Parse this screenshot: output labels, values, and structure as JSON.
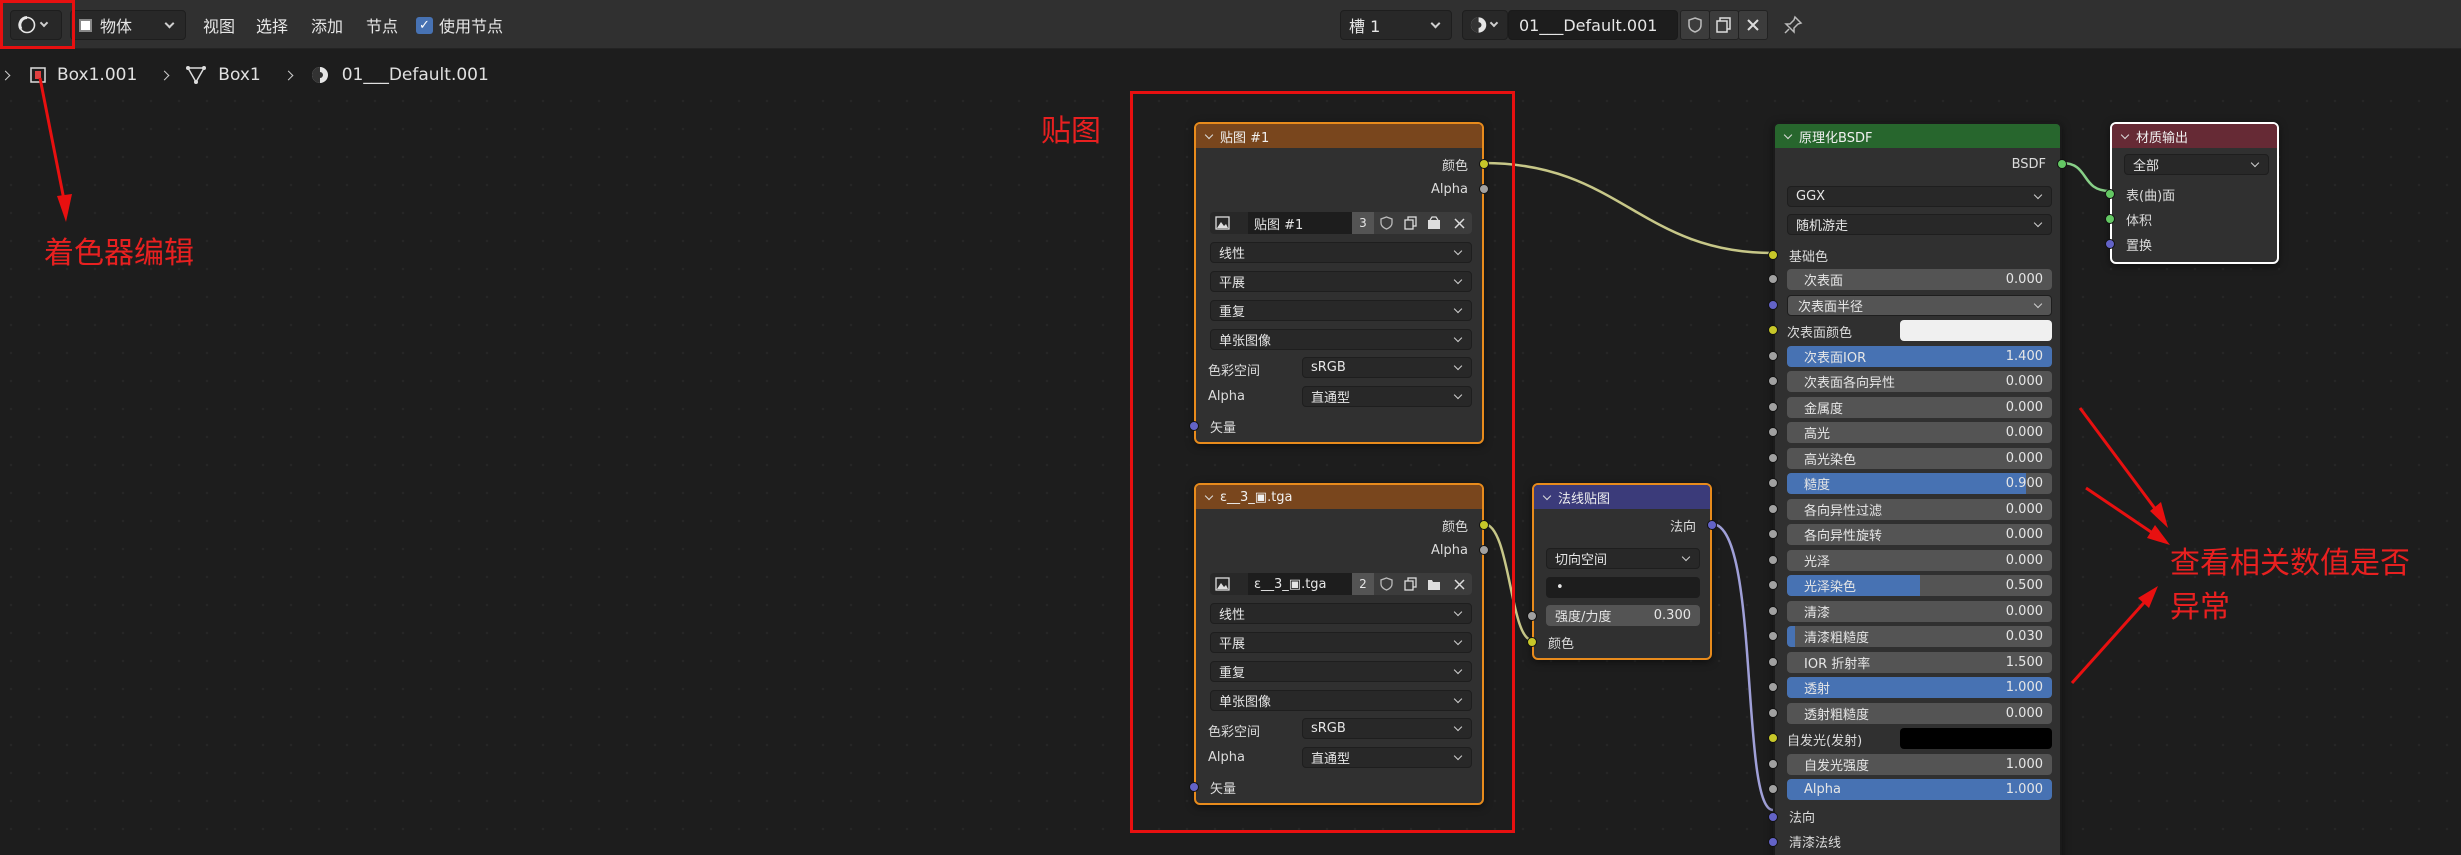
{
  "header": {
    "editor_type_icon": "shader-editor-icon",
    "object_mode": "物体",
    "menus": [
      "视图",
      "选择",
      "添加",
      "节点"
    ],
    "use_nodes_label": "使用节点",
    "use_nodes_checked": true,
    "slot": "槽 1",
    "material_name": "01___Default.001",
    "pin_icon": "pin-icon"
  },
  "breadcrumb": {
    "object": "Box1.001",
    "mesh": "Box1",
    "material": "01___Default.001"
  },
  "annotations": {
    "shader_editor": "着色器编辑",
    "texture": "贴图",
    "check_values_line1": "查看相关数值是否",
    "check_values_line2": "异常"
  },
  "tex1": {
    "title": "贴图 #1",
    "out_color": "颜色",
    "out_alpha": "Alpha",
    "image_name": "贴图 #1",
    "users": "3",
    "interpolation": "线性",
    "projection": "平展",
    "extension": "重复",
    "source": "单张图像",
    "colorspace_label": "色彩空间",
    "colorspace": "sRGB",
    "alpha_label": "Alpha",
    "alpha_mode": "直通型",
    "in_vector": "矢量"
  },
  "tex2": {
    "title": "ε__3_▣.tga",
    "out_color": "颜色",
    "out_alpha": "Alpha",
    "image_name": "ε__3_▣.tga",
    "users": "2",
    "interpolation": "线性",
    "projection": "平展",
    "extension": "重复",
    "source": "单张图像",
    "colorspace_label": "色彩空间",
    "colorspace": "sRGB",
    "alpha_label": "Alpha",
    "alpha_mode": "直通型",
    "in_vector": "矢量"
  },
  "normalmap": {
    "title": "法线贴图",
    "out_normal": "法向",
    "space": "切向空间",
    "uv": "•",
    "strength_label": "强度/力度",
    "strength": "0.300",
    "in_color": "颜色"
  },
  "bsdf": {
    "title": "原理化BSDF",
    "out": "BSDF",
    "distribution": "GGX",
    "subsurface_method": "随机游走",
    "base_color": "基础色",
    "fields": [
      {
        "label": "次表面",
        "value": "0.000",
        "fill": 0
      },
      {
        "label": "次表面半径",
        "value": "",
        "fill": 0,
        "dropdown": true
      },
      {
        "label": "次表面颜色",
        "value": "",
        "fill": 0,
        "color": "#f0f0f0"
      },
      {
        "label": "次表面IOR",
        "value": "1.400",
        "fill": 1
      },
      {
        "label": "次表面各向异性",
        "value": "0.000",
        "fill": 0
      },
      {
        "label": "金属度",
        "value": "0.000",
        "fill": 0
      },
      {
        "label": "高光",
        "value": "0.000",
        "fill": 0
      },
      {
        "label": "高光染色",
        "value": "0.000",
        "fill": 0
      },
      {
        "label": "糙度",
        "value": "0.900",
        "fill": 0.9
      },
      {
        "label": "各向异性过滤",
        "value": "0.000",
        "fill": 0
      },
      {
        "label": "各向异性旋转",
        "value": "0.000",
        "fill": 0
      },
      {
        "label": "光泽",
        "value": "0.000",
        "fill": 0
      },
      {
        "label": "光泽染色",
        "value": "0.500",
        "fill": 0.5
      },
      {
        "label": "清漆",
        "value": "0.000",
        "fill": 0
      },
      {
        "label": "清漆粗糙度",
        "value": "0.030",
        "fill": 0.03
      },
      {
        "label": "IOR 折射率",
        "value": "1.500",
        "fill": 0
      },
      {
        "label": "透射",
        "value": "1.000",
        "fill": 1
      },
      {
        "label": "透射粗糙度",
        "value": "0.000",
        "fill": 0
      },
      {
        "label": "自发光(发射)",
        "value": "",
        "fill": 0,
        "color": "#000000"
      },
      {
        "label": "自发光强度",
        "value": "1.000",
        "fill": 0
      },
      {
        "label": "Alpha",
        "value": "1.000",
        "fill": 1
      }
    ],
    "normal": "法向",
    "clearcoat_normal": "清漆法线"
  },
  "output": {
    "title": "材质输出",
    "target": "全部",
    "surface": "表(曲)面",
    "volume": "体积",
    "displacement": "置换"
  },
  "colors": {
    "texture_header": "#79461d",
    "vector_header": "#3b3b7a",
    "shader_header": "#27662d",
    "output_header": "#662a35",
    "socket_color": "#c7c729",
    "socket_float": "#a1a1a1",
    "socket_vector": "#6363c7",
    "socket_shader": "#63c763",
    "accent": "#4772b3"
  }
}
